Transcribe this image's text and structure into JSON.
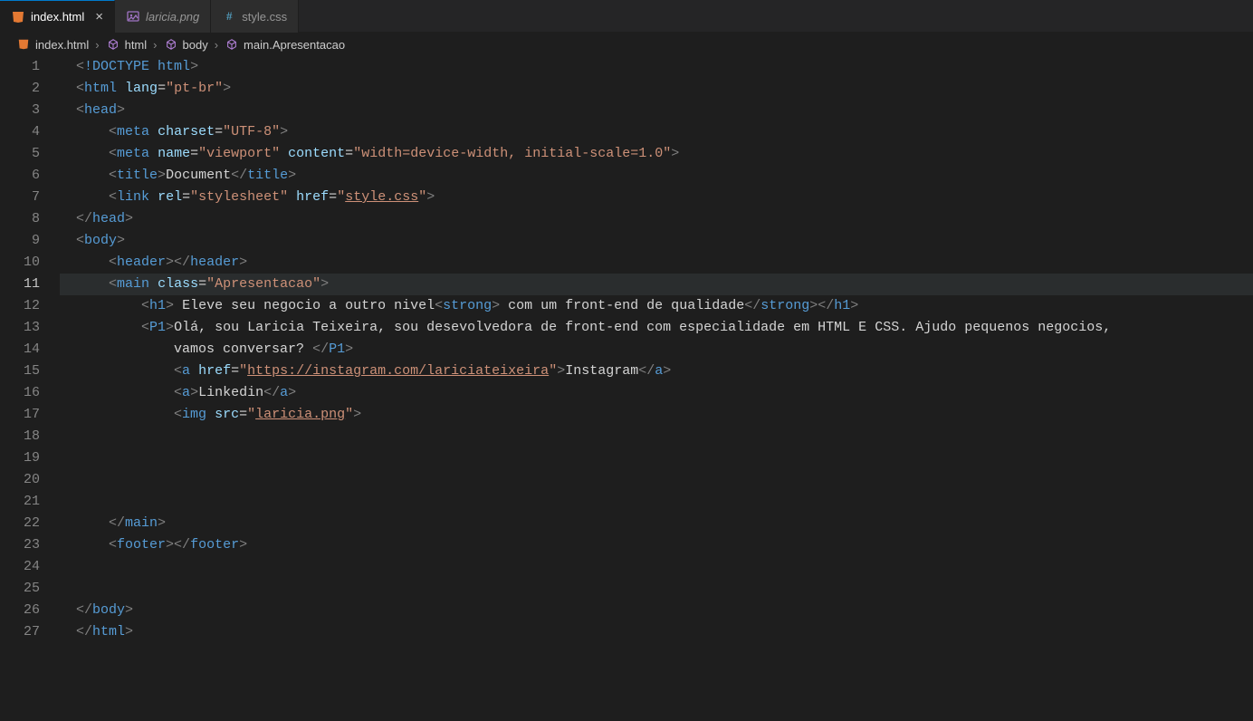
{
  "tabs": [
    {
      "label": "index.html",
      "iconColor": "#e37933",
      "active": true,
      "close": true
    },
    {
      "label": "laricia.png",
      "iconColor": "#a074c4",
      "active": false,
      "close": false
    },
    {
      "label": "style.css",
      "iconColor": "#519aba",
      "active": false,
      "close": false,
      "hash": true
    }
  ],
  "breadcrumbs": [
    {
      "label": "index.html",
      "icon": "html"
    },
    {
      "label": "html",
      "icon": "cube"
    },
    {
      "label": "body",
      "icon": "cube"
    },
    {
      "label": "main.Apresentacao",
      "icon": "cube"
    }
  ],
  "currentLine": 11,
  "lines": [
    "1",
    "2",
    "3",
    "4",
    "5",
    "6",
    "7",
    "8",
    "9",
    "10",
    "11",
    "12",
    "13",
    "14",
    "15",
    "16",
    "17",
    "18",
    "19",
    "20",
    "21",
    "22",
    "23",
    "24",
    "25",
    "26",
    "27"
  ],
  "code": {
    "l1": {
      "doctype": "!DOCTYPE",
      "kw": "html"
    },
    "l2": {
      "tag": "html",
      "attr": "lang",
      "val": "pt-br"
    },
    "l3": {
      "tag": "head"
    },
    "l4": {
      "tag": "meta",
      "attr": "charset",
      "val": "UTF-8"
    },
    "l5": {
      "tag": "meta",
      "attr1": "name",
      "val1": "viewport",
      "attr2": "content",
      "val2": "width=device-width, initial-scale=1.0"
    },
    "l6": {
      "tag": "title",
      "text": "Document"
    },
    "l7": {
      "tag": "link",
      "attr1": "rel",
      "val1": "stylesheet",
      "attr2": "href",
      "val2": "style.css"
    },
    "l8": {
      "tag": "head"
    },
    "l9": {
      "tag": "body"
    },
    "l10": {
      "tag": "header"
    },
    "l11": {
      "tag": "main",
      "attr": "class",
      "val": "Apresentacao"
    },
    "l12": {
      "tag": "h1",
      "t1": " Eleve seu negocio a outro nivel",
      "strong": "strong",
      "t2": " com um front-end de qualidade"
    },
    "l13": {
      "tag": "P1",
      "text": "Olá, sou Laricia Teixeira, sou desevolvedora de front-end com especialidade em HTML E CSS. Ajudo pequenos negocios,"
    },
    "l14": {
      "text": "vamos conversar? ",
      "close": "P1"
    },
    "l15": {
      "tag": "a",
      "attr": "href",
      "val": "https://instagram.com/lariciateixeira",
      "text": "Instagram"
    },
    "l16": {
      "tag": "a",
      "text": "Linkedin"
    },
    "l17": {
      "tag": "img",
      "attr": "src",
      "val": "laricia.png"
    },
    "l22": {
      "tag": "main"
    },
    "l23": {
      "tag": "footer"
    },
    "l26": {
      "tag": "body"
    },
    "l27": {
      "tag": "html"
    }
  }
}
